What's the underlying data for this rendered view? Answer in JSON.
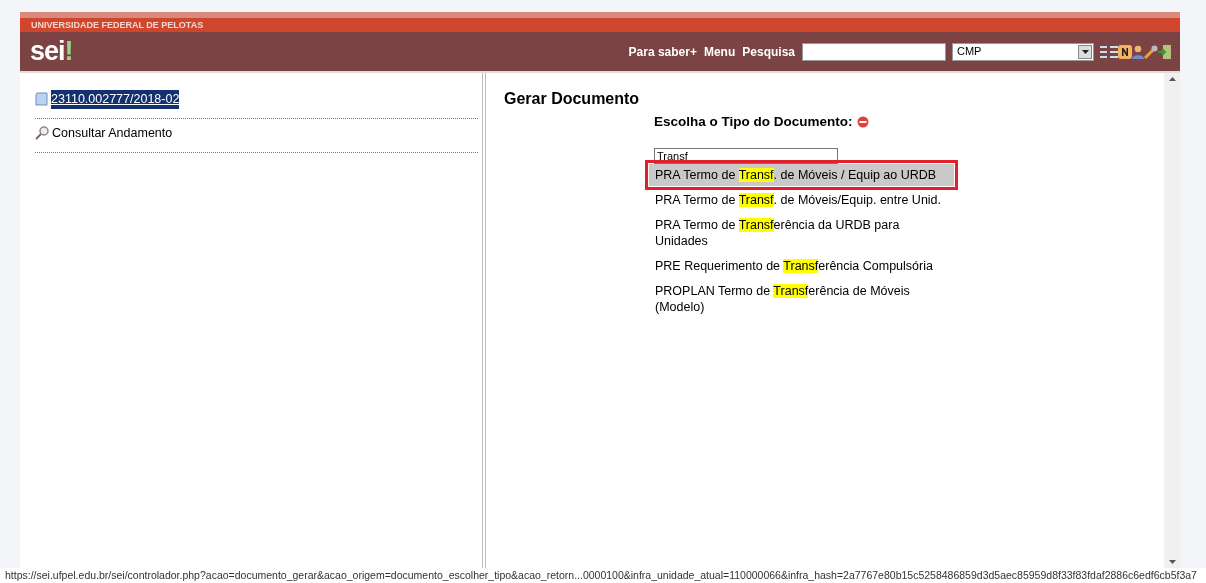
{
  "header": {
    "institution": "UNIVERSIDADE FEDERAL DE PELOTAS",
    "logo": "sei",
    "logo_mark": "!",
    "links": [
      "Para saber+",
      "Menu",
      "Pesquisa"
    ],
    "unit_select": {
      "value": "CMP"
    }
  },
  "sidebar": {
    "items": [
      {
        "kind": "process",
        "label": "23110.002777/2018-02",
        "selected": true
      },
      {
        "kind": "search",
        "label": "Consultar Andamento",
        "selected": false
      }
    ]
  },
  "main": {
    "title": "Gerar Documento",
    "subtitle": "Escolha o Tipo do Documento:",
    "filter": {
      "value": "Transf"
    },
    "options": [
      {
        "before": "PRA Termo de ",
        "match": "Transf",
        "after": ". de Móveis / Equip ao URDB",
        "selected": true
      },
      {
        "before": "PRA Termo de ",
        "match": "Transf",
        "after": ". de Móveis/Equip. entre Unid.",
        "selected": false
      },
      {
        "before": "PRA Termo de ",
        "match": "Transf",
        "after": "erência da URDB para Unidades",
        "selected": false
      },
      {
        "before": "PRE Requerimento de ",
        "match": "Transf",
        "after": "erência Compulsória",
        "selected": false
      },
      {
        "before": "PROPLAN Termo de ",
        "match": "Transf",
        "after": "erência de Móveis (Modelo)",
        "selected": false
      }
    ]
  },
  "status_bar": "https://sei.ufpel.edu.br/sei/controlador.php?acao=documento_gerar&acao_origem=documento_escolher_tipo&acao_retorn...0000100&infra_unidade_atual=110000066&infra_hash=2a7767e80b15c5258486859d3d5aec85959d8f33f83fdaf2886c6edf6cb5f3a7"
}
